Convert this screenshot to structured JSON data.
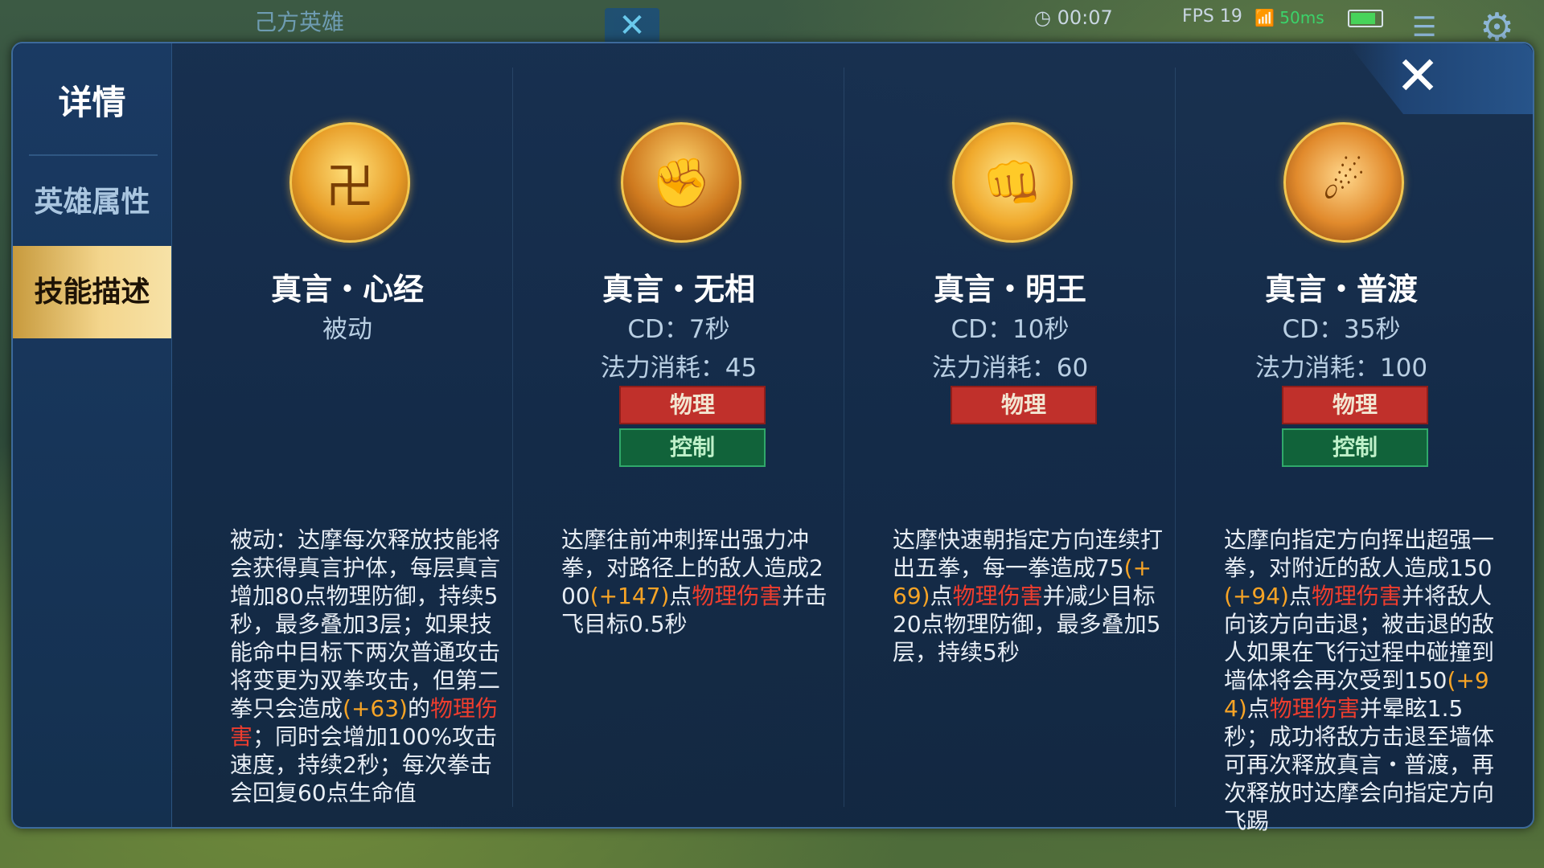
{
  "hud": {
    "team_title": "己方英雄",
    "close_small": "✕",
    "timer": "00:07",
    "fps": "FPS 19",
    "ping": "50ms",
    "gear_icon": "⚙",
    "list_icon": "☰"
  },
  "panel": {
    "title": "详情",
    "close_label": "✕",
    "tabs": [
      {
        "label": "英雄属性",
        "selected": false
      },
      {
        "label": "技能描述",
        "selected": true
      }
    ]
  },
  "colors": {
    "accent_gold": "#f3d58c",
    "damage_red": "#ee3d2e",
    "bonus_yellow": "#f7a426",
    "tag_physical": "#c0302b",
    "tag_control": "#11633a"
  },
  "skills": [
    {
      "icon": "passive-emblem-icon",
      "name": "真言・心经",
      "meta1": "被动",
      "meta2": "",
      "tags": [],
      "desc": {
        "p1": "被动：达摩每次释放技能将会获得真言护体，每层真言增加80点物理防御，持续5秒，最多叠加3层；如果技能命中目标下两次普通攻击将变更为双拳攻击，但第二拳只会造成",
        "y1": "(+63)",
        "p2": "的",
        "r1": "物理伤害",
        "p3": "；同时会增加100%攻击速度，持续2秒；每次拳击会回复60点生命值"
      }
    },
    {
      "icon": "punch-dash-icon",
      "name": "真言・无相",
      "meta1": "CD：7秒",
      "meta2": "法力消耗：45",
      "tags": [
        "物理",
        "控制"
      ],
      "desc": {
        "p1": "达摩往前冲刺挥出强力冲拳，对路径上的敌人造成200",
        "y1": "(+147)",
        "p2": "点",
        "r1": "物理伤害",
        "p3": "并击飞目标0.5秒"
      }
    },
    {
      "icon": "multi-fist-icon",
      "name": "真言・明王",
      "meta1": "CD：10秒",
      "meta2": "法力消耗：60",
      "tags": [
        "物理"
      ],
      "desc": {
        "p1": "达摩快速朝指定方向连续打出五拳，每一拳造成75",
        "y1": "(+69)",
        "p2": "点",
        "r1": "物理伤害",
        "p3": "并减少目标20点物理防御，最多叠加5层，持续5秒"
      }
    },
    {
      "icon": "ultimate-strike-icon",
      "name": "真言・普渡",
      "meta1": "CD：35秒",
      "meta2": "法力消耗：100",
      "tags": [
        "物理",
        "控制"
      ],
      "desc": {
        "p1": "达摩向指定方向挥出超强一拳，对附近的敌人造成150",
        "y1": "(+94)",
        "p2": "点",
        "r1": "物理伤害",
        "p3": "并将敌人向该方向击退；被击退的敌人如果在飞行过程中碰撞到墙体将会再次受到150",
        "y2": "(+94)",
        "p4": "点",
        "r2": "物理伤害",
        "p5": "并晕眩1.5秒；成功将敌方击退至墙体可再次释放真言・普渡，再次释放时达摩会向指定方向飞踢"
      }
    }
  ]
}
